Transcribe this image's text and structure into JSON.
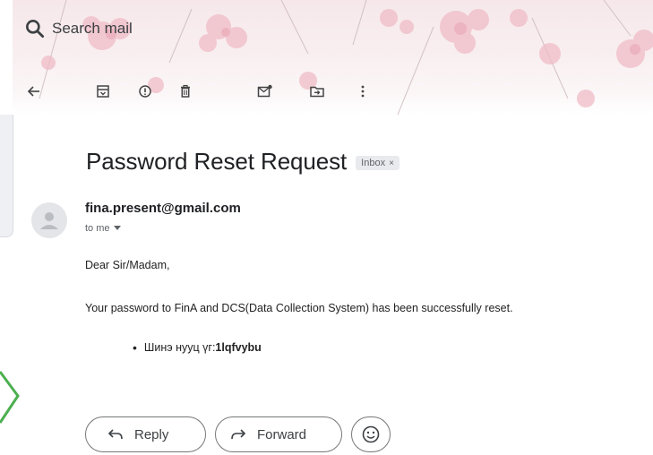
{
  "search": {
    "placeholder": "Search mail"
  },
  "toolbar": {
    "items": [
      "back-arrow-icon",
      "archive-icon",
      "report-spam-icon",
      "delete-icon",
      "mark-unread-icon",
      "move-to-icon",
      "more-icon"
    ]
  },
  "email": {
    "subject": "Password Reset Request",
    "label_chip": "Inbox",
    "chip_close": "×",
    "sender": "fina.present@gmail.com",
    "recipient_line": "to me",
    "greeting": "Dear Sir/Madam,",
    "body_line": "Your password to FinA and DCS(Data Collection System) has been successfully reset.",
    "bullet_label": "Шинэ нууц үг: ",
    "bullet_value": "1lqfvybu"
  },
  "actions": {
    "reply": "Reply",
    "forward": "Forward"
  },
  "colors": {
    "accent_green": "#4caf50",
    "floral_pink": "#f2c6cf"
  }
}
